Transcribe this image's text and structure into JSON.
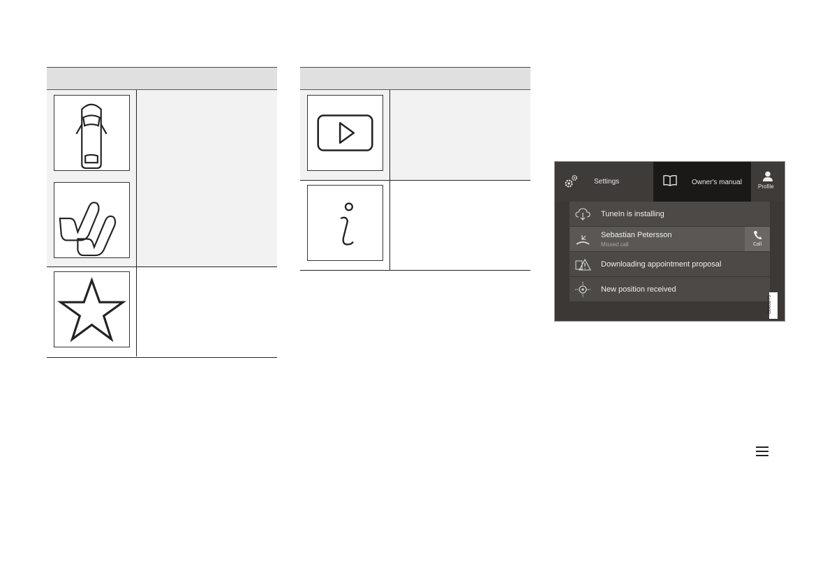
{
  "icons": {
    "table_a": [
      "car-doors-icon",
      "seats-icon",
      "star-icon"
    ],
    "table_b": [
      "play-icon",
      "info-icon"
    ]
  },
  "screen": {
    "settings_label": "Settings",
    "manual_label": "Owner's manual",
    "profile_label": "Profile",
    "notifications": [
      {
        "title": "TuneIn is installing",
        "icon": "cloud-download-icon"
      },
      {
        "title": "Sebastian Petersson",
        "subtitle": "Missed call",
        "icon": "missed-call-icon",
        "action": "Call"
      },
      {
        "title": "Downloading appointment proposal",
        "icon": "warning-document-icon"
      },
      {
        "title": "New position received",
        "icon": "position-icon"
      }
    ],
    "image_code": "G063275"
  },
  "colors": {
    "table_header": "#e0e0e0",
    "shaded_row": "#f2f2f2",
    "screen_bg": "#3b3836",
    "manual_tab_bg": "#1b1918"
  }
}
